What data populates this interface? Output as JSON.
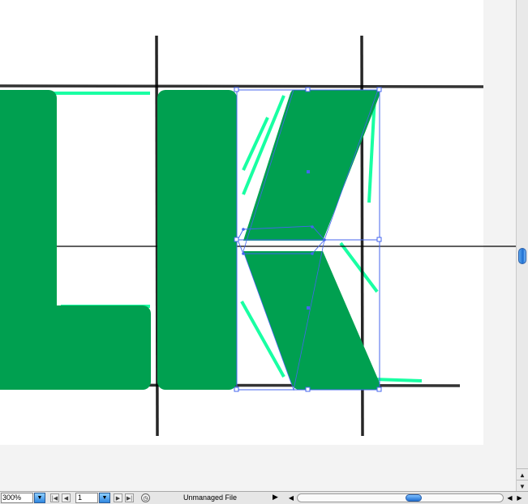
{
  "colors": {
    "glyph_fill": "#00a050",
    "trace": "#00ff99",
    "selection": "#4466ee",
    "guide": "#000000"
  },
  "statusbar": {
    "zoom": "300%",
    "page": "1",
    "status_text": "Unmanaged File",
    "icons": {
      "zoom_dropdown": "chevron-down-icon",
      "first": "first-page-icon",
      "prev": "prev-page-icon",
      "next": "next-page-icon",
      "last": "last-page-icon",
      "status": "status-clock-icon",
      "menu": "triangle-right-icon"
    }
  },
  "scrollbars": {
    "vertical_position": 0.52,
    "horizontal_position": 0.55
  }
}
